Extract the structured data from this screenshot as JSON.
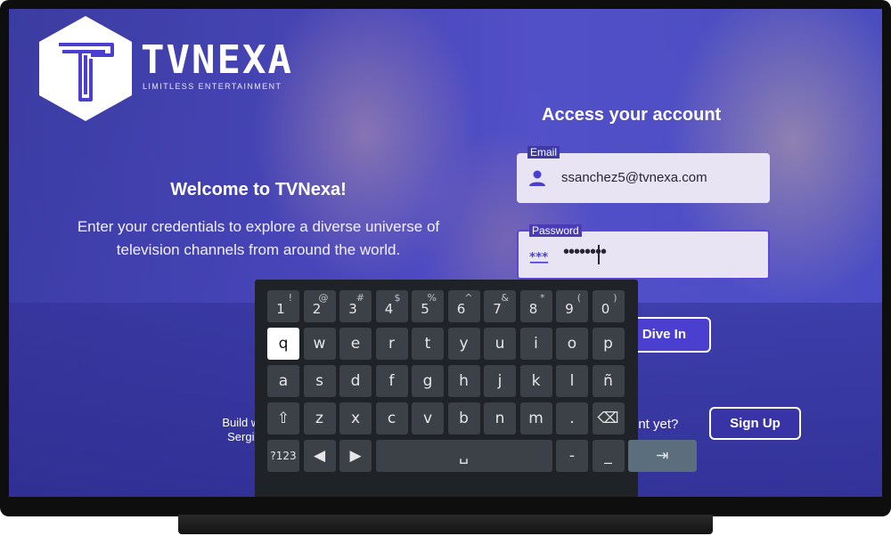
{
  "brand": {
    "name": "TVNEXA",
    "tagline": "LIMITLESS ENTERTAINMENT"
  },
  "welcome": {
    "title": "Welcome to TVNexa!",
    "description": "Enter your credentials to explore a diverse universe of television channels from around the world."
  },
  "credits": {
    "line1": "Build with",
    "line2": "Sergio S"
  },
  "login": {
    "title": "Access your account",
    "email": {
      "label": "Email",
      "value": "ssanchez5@tvnexa.com",
      "icon": "person-icon"
    },
    "password": {
      "label": "Password",
      "masked": "••••••••",
      "icon": "asterisks-icon"
    },
    "submit_label": "Dive In"
  },
  "signup": {
    "question": "unt yet?",
    "button_label": "Sign Up"
  },
  "keyboard": {
    "focused_key": "q",
    "rows": [
      [
        {
          "k": "1",
          "a": "!"
        },
        {
          "k": "2",
          "a": "@"
        },
        {
          "k": "3",
          "a": "#"
        },
        {
          "k": "4",
          "a": "$"
        },
        {
          "k": "5",
          "a": "%"
        },
        {
          "k": "6",
          "a": "^"
        },
        {
          "k": "7",
          "a": "&"
        },
        {
          "k": "8",
          "a": "*"
        },
        {
          "k": "9",
          "a": "("
        },
        {
          "k": "0",
          "a": ")"
        }
      ],
      [
        {
          "k": "q"
        },
        {
          "k": "w"
        },
        {
          "k": "e"
        },
        {
          "k": "r"
        },
        {
          "k": "t"
        },
        {
          "k": "y"
        },
        {
          "k": "u"
        },
        {
          "k": "i"
        },
        {
          "k": "o"
        },
        {
          "k": "p"
        }
      ],
      [
        {
          "k": "a"
        },
        {
          "k": "s"
        },
        {
          "k": "d"
        },
        {
          "k": "f"
        },
        {
          "k": "g"
        },
        {
          "k": "h"
        },
        {
          "k": "j"
        },
        {
          "k": "k"
        },
        {
          "k": "l"
        },
        {
          "k": "ñ"
        }
      ],
      [
        {
          "k": "⇧"
        },
        {
          "k": "z"
        },
        {
          "k": "x"
        },
        {
          "k": "c"
        },
        {
          "k": "v"
        },
        {
          "k": "b"
        },
        {
          "k": "n"
        },
        {
          "k": "m"
        },
        {
          "k": "."
        },
        {
          "k": "⌫"
        }
      ],
      [
        {
          "k": "?123"
        },
        {
          "k": "◀"
        },
        {
          "k": "▶"
        },
        {
          "k": "␣"
        },
        {
          "k": "-"
        },
        {
          "k": "_"
        },
        {
          "k": "⇥"
        }
      ]
    ]
  },
  "colors": {
    "accent": "#4b3fd0",
    "field_bg": "#e9e4f3",
    "keyboard_bg": "#1f2227",
    "key_bg": "#3c4047",
    "action_key": "#5a6e7e"
  }
}
